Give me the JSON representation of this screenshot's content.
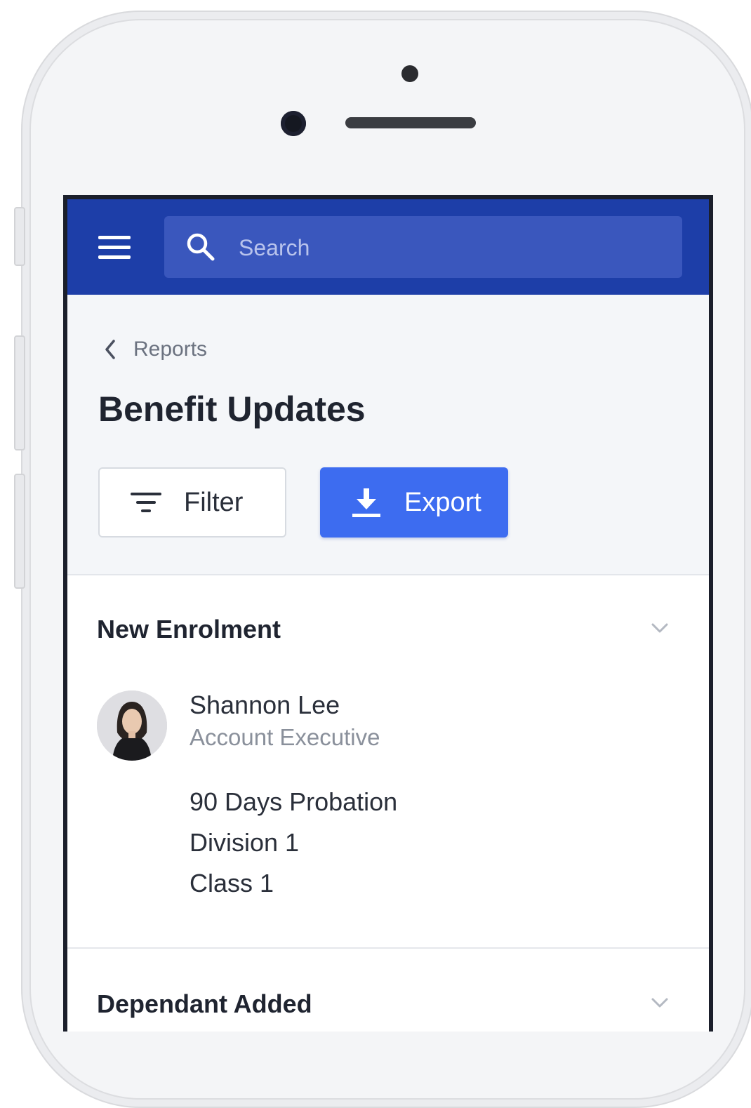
{
  "search": {
    "placeholder": "Search"
  },
  "breadcrumb": {
    "label": "Reports"
  },
  "page": {
    "title": "Benefit Updates"
  },
  "actions": {
    "filter_label": "Filter",
    "export_label": "Export"
  },
  "sections": [
    {
      "title": "New Enrolment",
      "person": {
        "name": "Shannon Lee",
        "role": "Account Executive"
      },
      "details": [
        "90 Days Probation",
        "Division 1",
        "Class 1"
      ]
    },
    {
      "title": "Dependant Added"
    }
  ],
  "colors": {
    "topbar": "#1d3ea8",
    "search_box": "#3a57bd",
    "export_button": "#3d6cf0",
    "header_background": "#f4f6f9"
  },
  "icons": {
    "menu": "hamburger-icon",
    "search": "search-icon",
    "back": "chevron-left-icon",
    "filter": "filter-icon",
    "export": "download-icon",
    "collapse": "chevron-down-icon"
  }
}
